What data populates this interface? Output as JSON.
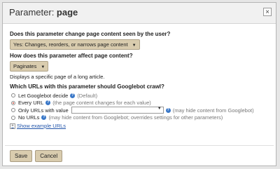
{
  "dialog": {
    "title_prefix": "Parameter: ",
    "title_param": "page",
    "close_symbol": "×"
  },
  "q1": {
    "question": "Does this parameter change page content seen by the user?",
    "selected": "Yes: Changes, reorders, or narrows page content"
  },
  "q2": {
    "question": "How does this parameter affect page content?",
    "selected": "Paginates",
    "description": "Displays a specific page of a long article."
  },
  "q3": {
    "question": "Which URLs with this parameter should Googlebot crawl?",
    "options": [
      {
        "label": "Let Googlebot decide",
        "note": "(Default)",
        "selected": false
      },
      {
        "label": "Every URL",
        "note": "(the page content changes for each value)",
        "selected": true
      },
      {
        "label": "Only URLs with value",
        "note": "(may hide content from Googlebot)",
        "selected": false
      },
      {
        "label": "No URLs",
        "note": "(may hide content from Googlebot; overrides settings for other parameters)",
        "selected": false
      }
    ],
    "help_symbol": "?"
  },
  "show_examples": {
    "label": "Show example URLs",
    "toggle": "+"
  },
  "buttons": {
    "save": "Save",
    "cancel": "Cancel"
  },
  "colors": {
    "button_bg": "#d9ccae",
    "help_icon": "#3a78c8",
    "radio_selected": "#c6422e"
  },
  "icons": {
    "close": "close-icon",
    "help": "help-icon",
    "dropdown": "chevron-down-icon"
  }
}
